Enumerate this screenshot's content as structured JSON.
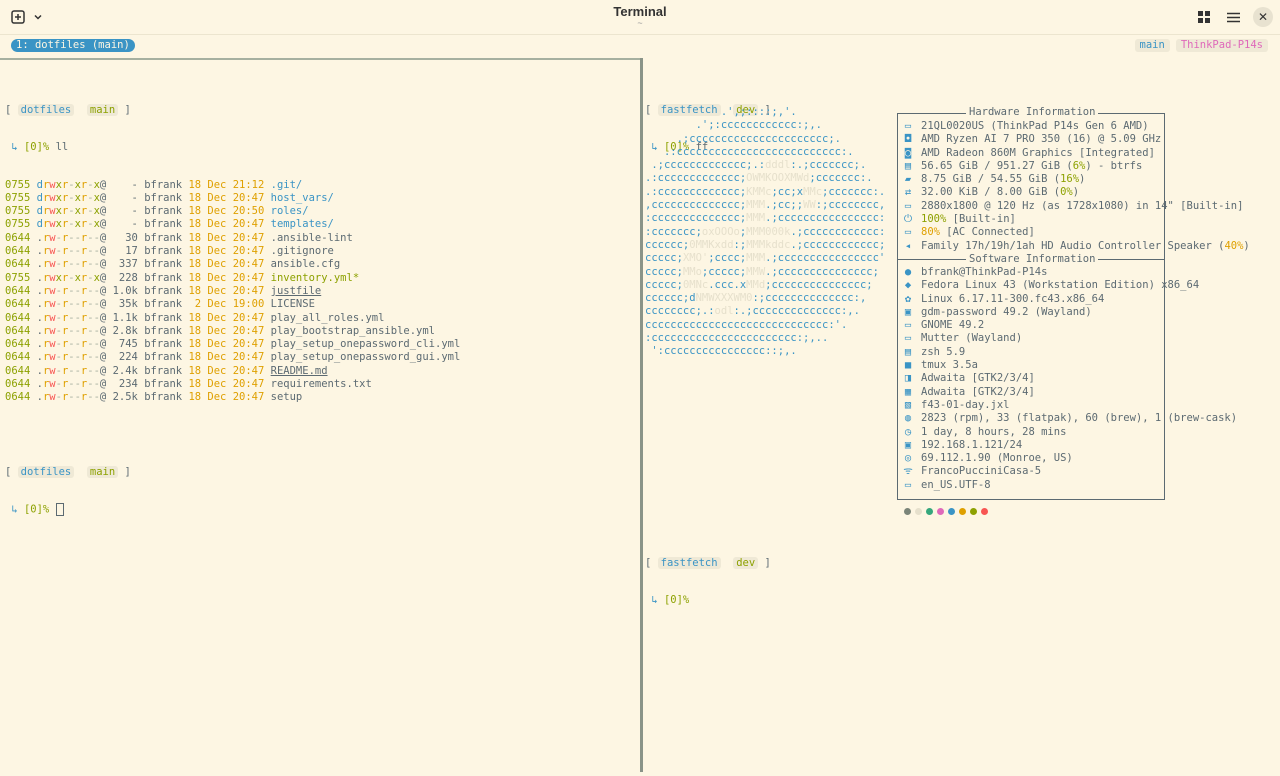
{
  "window": {
    "title": "Terminal",
    "subtitle": "~"
  },
  "tmux": {
    "window_tab": "1: dotfiles (main)",
    "status_branch": "main",
    "status_host": "ThinkPad-P14s"
  },
  "left_pane": {
    "prompt1": {
      "dir": "dotfiles",
      "branch": "main",
      "status": "[0]%",
      "command": "ll"
    },
    "files": [
      {
        "mode": "0755",
        "perm": "drwxr-xr-x@",
        "size": "-",
        "owner": "bfrank",
        "date": "18 Dec 21:12",
        "name": ".git/",
        "kind": "dir"
      },
      {
        "mode": "0755",
        "perm": "drwxr-xr-x@",
        "size": "-",
        "owner": "bfrank",
        "date": "18 Dec 20:47",
        "name": "host_vars/",
        "kind": "dir"
      },
      {
        "mode": "0755",
        "perm": "drwxr-xr-x@",
        "size": "-",
        "owner": "bfrank",
        "date": "18 Dec 20:50",
        "name": "roles/",
        "kind": "dir"
      },
      {
        "mode": "0755",
        "perm": "drwxr-xr-x@",
        "size": "-",
        "owner": "bfrank",
        "date": "18 Dec 20:47",
        "name": "templates/",
        "kind": "dir"
      },
      {
        "mode": "0644",
        "perm": ".rw-r--r--@",
        "size": "30",
        "owner": "bfrank",
        "date": "18 Dec 20:47",
        "name": ".ansible-lint",
        "kind": "file"
      },
      {
        "mode": "0644",
        "perm": ".rw-r--r--@",
        "size": "17",
        "owner": "bfrank",
        "date": "18 Dec 20:47",
        "name": ".gitignore",
        "kind": "file"
      },
      {
        "mode": "0644",
        "perm": ".rw-r--r--@",
        "size": "337",
        "owner": "bfrank",
        "date": "18 Dec 20:47",
        "name": "ansible.cfg",
        "kind": "file"
      },
      {
        "mode": "0755",
        "perm": ".rwxr-xr-x@",
        "size": "228",
        "owner": "bfrank",
        "date": "18 Dec 20:47",
        "name": "inventory.yml*",
        "kind": "exec"
      },
      {
        "mode": "0644",
        "perm": ".rw-r--r--@",
        "size": "1.0k",
        "owner": "bfrank",
        "date": "18 Dec 20:47",
        "name": "justfile",
        "kind": "ul"
      },
      {
        "mode": "0644",
        "perm": ".rw-r--r--@",
        "size": "35k",
        "owner": "bfrank",
        "date": " 2 Dec 19:00",
        "name": "LICENSE",
        "kind": "file"
      },
      {
        "mode": "0644",
        "perm": ".rw-r--r--@",
        "size": "1.1k",
        "owner": "bfrank",
        "date": "18 Dec 20:47",
        "name": "play_all_roles.yml",
        "kind": "file"
      },
      {
        "mode": "0644",
        "perm": ".rw-r--r--@",
        "size": "2.8k",
        "owner": "bfrank",
        "date": "18 Dec 20:47",
        "name": "play_bootstrap_ansible.yml",
        "kind": "file"
      },
      {
        "mode": "0644",
        "perm": ".rw-r--r--@",
        "size": "745",
        "owner": "bfrank",
        "date": "18 Dec 20:47",
        "name": "play_setup_onepassword_cli.yml",
        "kind": "file"
      },
      {
        "mode": "0644",
        "perm": ".rw-r--r--@",
        "size": "224",
        "owner": "bfrank",
        "date": "18 Dec 20:47",
        "name": "play_setup_onepassword_gui.yml",
        "kind": "file"
      },
      {
        "mode": "0644",
        "perm": ".rw-r--r--@",
        "size": "2.4k",
        "owner": "bfrank",
        "date": "18 Dec 20:47",
        "name": "README.md",
        "kind": "ul"
      },
      {
        "mode": "0644",
        "perm": ".rw-r--r--@",
        "size": "234",
        "owner": "bfrank",
        "date": "18 Dec 20:47",
        "name": "requirements.txt",
        "kind": "file"
      },
      {
        "mode": "0644",
        "perm": ".rw-r--r--@",
        "size": "2.5k",
        "owner": "bfrank",
        "date": "18 Dec 20:47",
        "name": "setup",
        "kind": "file"
      }
    ],
    "prompt2": {
      "dir": "dotfiles",
      "branch": "main",
      "status": "[0]%"
    }
  },
  "right_pane": {
    "prompt1": {
      "dir": "fastfetch",
      "branch": "dev",
      "status": "[0]%",
      "command": "ff"
    },
    "logo": [
      "            .',;::::;,'.",
      "        .';:cccccccccccc:;,.",
      "     .;cccccccccccccccccccccc;.",
      "   .:cccccccccccccccccccccccccc:.",
      " .;ccccccccccccc;.:dddl:.;ccccccc;.",
      ".:ccccccccccccc;OWMKOOXMWd;ccccccc:.",
      ".:ccccccccccccc;KMMc;cc;xMMc;ccccccc:.",
      ",cccccccccccccc;MMM.;cc;;WW:;cccccccc,",
      ":cccccccccccccc;MMM.;cccccccccccccccc:",
      ":ccccccc;oxOOOo;MMM000k.;cccccccccccc:",
      "cccccc;0MMKxdd:;MMMkddc.;cccccccccccc;",
      "ccccc;XMO';cccc;MMM.;cccccccccccccccc'",
      "ccccc;MMo;ccccc;MMW.;ccccccccccccccc;",
      "ccccc;0MNc.ccc.xMMd;ccccccccccccccc;",
      "cccccc;dNMWXXXWM0:;cccccccccccccc:,",
      "cccccccc;.:odl:.;cccccccccccccc:,.",
      "ccccccccccccccccccccccccccccc:'.",
      ":ccccccccccccccccccccccc:;,..",
      " ':cccccccccccccccc::;,."
    ],
    "hw_title": "Hardware Information",
    "sw_title": "Software Information",
    "hardware": [
      {
        "icon": "host-icon",
        "glyph": "▭",
        "text": "21QL0020US (ThinkPad P14s Gen 6 AMD)"
      },
      {
        "icon": "cpu-icon",
        "glyph": "◘",
        "text": "AMD Ryzen AI 7 PRO 350 (16) @ 5.09 GHz"
      },
      {
        "icon": "gpu-icon",
        "glyph": "◙",
        "text": "AMD Radeon 860M Graphics [Integrated]"
      },
      {
        "icon": "disk-icon",
        "glyph": "▤",
        "text": "56.65 GiB / 951.27 GiB (",
        "pct": "6%",
        "pct_color": "pct-g",
        "after": ") - btrfs"
      },
      {
        "icon": "memory-icon",
        "glyph": "▰",
        "text": "8.75 GiB / 54.55 GiB (",
        "pct": "16%",
        "pct_color": "pct-g",
        "after": ")"
      },
      {
        "icon": "swap-icon",
        "glyph": "⇄",
        "text": "32.00 KiB / 8.00 GiB (",
        "pct": "0%",
        "pct_color": "pct-g",
        "after": ")"
      },
      {
        "icon": "display-icon",
        "glyph": "▭",
        "text": "2880x1800 @ 120 Hz (as 1728x1080) in 14\" [Built-in]"
      },
      {
        "icon": "power-icon",
        "glyph": "⏻",
        "text": "",
        "pct": "100%",
        "pct_color": "pct-g",
        "after": " [Built-in]"
      },
      {
        "icon": "battery-icon",
        "glyph": "▭",
        "text": "",
        "pct": "80%",
        "pct_color": "pct-y",
        "after": " [AC Connected]"
      },
      {
        "icon": "sound-icon",
        "glyph": "◂",
        "text": "Family 17h/19h/1ah HD Audio Controller Speaker (",
        "pct": "40%",
        "pct_color": "pct-y",
        "after": ")"
      }
    ],
    "software": [
      {
        "icon": "user-icon",
        "glyph": "●",
        "text": "bfrank@ThinkPad-P14s"
      },
      {
        "icon": "os-icon",
        "glyph": "◆",
        "text": "Fedora Linux 43 (Workstation Edition) x86_64"
      },
      {
        "icon": "kernel-icon",
        "glyph": "✿",
        "text": "Linux 6.17.11-300.fc43.x86_64"
      },
      {
        "icon": "login-icon",
        "glyph": "▣",
        "text": "gdm-password 49.2 (Wayland)"
      },
      {
        "icon": "de-icon",
        "glyph": "▭",
        "text": "GNOME 49.2"
      },
      {
        "icon": "wm-icon",
        "glyph": "▭",
        "text": "Mutter (Wayland)"
      },
      {
        "icon": "shell-icon",
        "glyph": "▤",
        "text": "zsh 5.9"
      },
      {
        "icon": "terminal-icon",
        "glyph": "■",
        "text": "tmux 3.5a"
      },
      {
        "icon": "theme-icon",
        "glyph": "◨",
        "text": "Adwaita [GTK2/3/4]"
      },
      {
        "icon": "icons-icon",
        "glyph": "▦",
        "text": "Adwaita [GTK2/3/4]"
      },
      {
        "icon": "wallpaper-icon",
        "glyph": "▧",
        "text": "f43-01-day.jxl"
      },
      {
        "icon": "packages-icon",
        "glyph": "◍",
        "text": "2823 (rpm), 33 (flatpak), 60 (brew), 1 (brew-cask)"
      },
      {
        "icon": "uptime-icon",
        "glyph": "◷",
        "text": "1 day, 8 hours, 28 mins"
      },
      {
        "icon": "local-ip-icon",
        "glyph": "▣",
        "text": "192.168.1.121/24"
      },
      {
        "icon": "public-ip-icon",
        "glyph": "◎",
        "text": "69.112.1.90 (Monroe, US)"
      },
      {
        "icon": "wifi-icon",
        "glyph": "ᯤ",
        "text": "FrancoPucciniCasa-5"
      },
      {
        "icon": "locale-icon",
        "glyph": "▭",
        "text": "en_US.UTF-8"
      }
    ],
    "palette": [
      "#7a8478",
      "#e6e0cc",
      "#35a77c",
      "#df69ba",
      "#3a94c5",
      "#dfa000",
      "#8da101",
      "#f85552"
    ],
    "prompt2": {
      "dir": "fastfetch",
      "branch": "dev",
      "status": "[0]%"
    }
  }
}
